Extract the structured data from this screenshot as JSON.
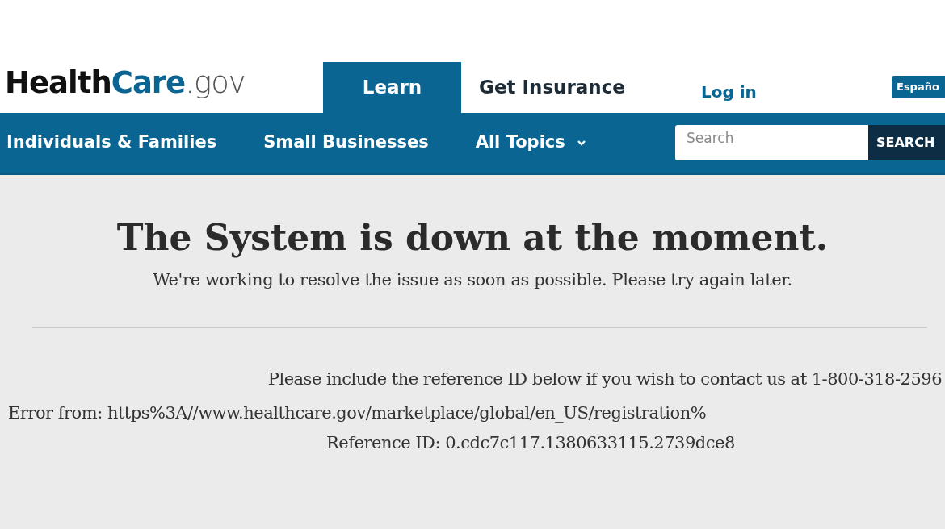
{
  "logo": {
    "part_a": "Health",
    "part_b": "Care",
    "suffix": ".gov"
  },
  "tabs": [
    {
      "label": "Learn",
      "selected": true
    },
    {
      "label": "Get Insurance",
      "selected": false
    }
  ],
  "login_link": "Log in",
  "language_button": "Españo",
  "subnav": [
    {
      "label": "Individuals & Families",
      "kind": "link"
    },
    {
      "label": "Small Businesses",
      "kind": "link"
    },
    {
      "label": "All Topics",
      "kind": "dropdown"
    }
  ],
  "search": {
    "placeholder": "Search",
    "button": "SEARCH"
  },
  "message": {
    "title": "The System is down at the moment.",
    "subtitle": "We're working to resolve the issue as soon as possible. Please try again later.",
    "contact_line": "Please include the reference ID below if you wish to contact us at 1-800-318-2596",
    "error_line": "Error from: https%3A//www.healthcare.gov/marketplace/global/en_US/registration%",
    "reference_line": "Reference ID: 0.cdc7c117.1380633115.2739dce8"
  }
}
